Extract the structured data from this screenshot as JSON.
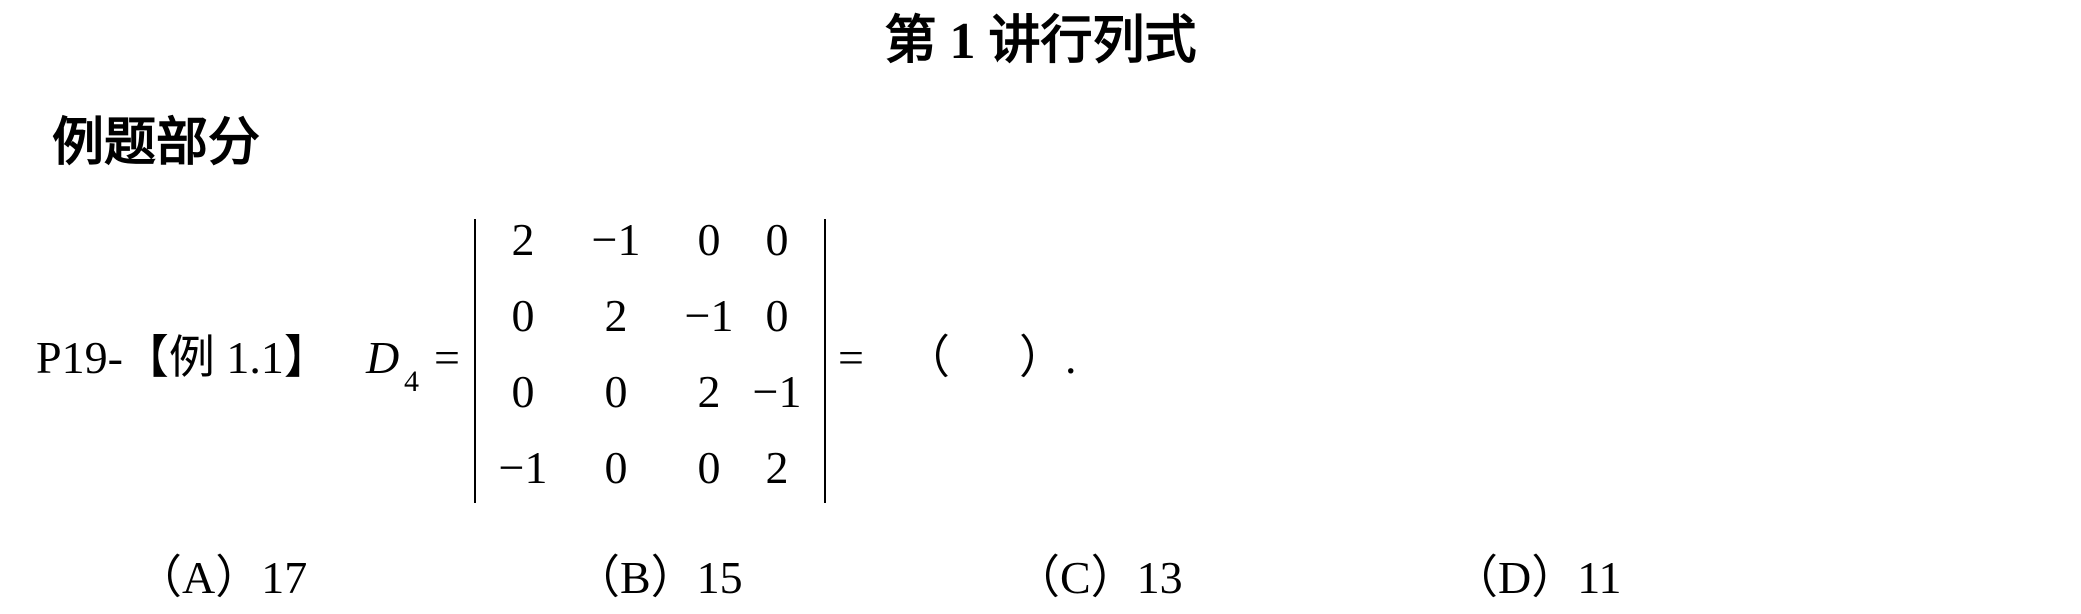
{
  "document": {
    "title": "第 1 讲行列式",
    "section_heading": "例题部分"
  },
  "problem": {
    "ref": "P19-【例 1.1】",
    "variable": "D",
    "subscript": "4",
    "equals": "=",
    "blank": "（      ）."
  },
  "matrix": {
    "rows": [
      [
        "2",
        "−1",
        "0",
        "0"
      ],
      [
        "0",
        "2",
        "−1",
        "0"
      ],
      [
        "0",
        "0",
        "2",
        "−1"
      ],
      [
        "−1",
        "0",
        "0",
        "2"
      ]
    ]
  },
  "choices": [
    {
      "label": "（A）17"
    },
    {
      "label": "（B）15"
    },
    {
      "label": "（C）13"
    },
    {
      "label": "（D）11"
    }
  ]
}
